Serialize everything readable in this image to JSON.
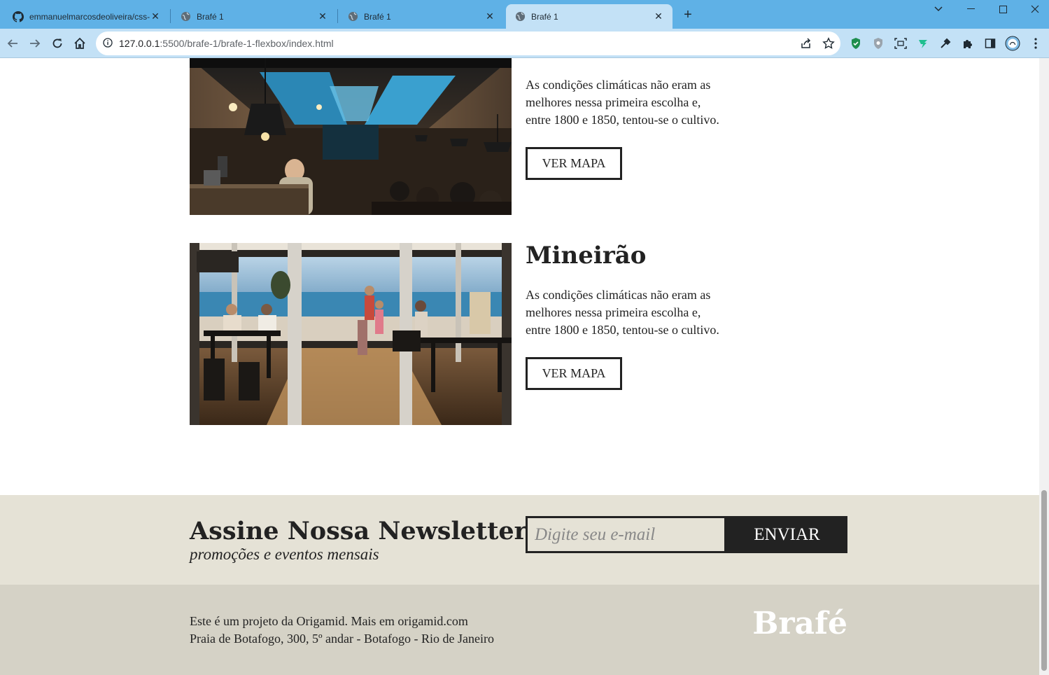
{
  "browser": {
    "tabs": [
      {
        "title": "emmanuelmarcosdeoliveira/css-a",
        "icon": "github-icon"
      },
      {
        "title": "Brafé 1",
        "icon": "globe-icon"
      },
      {
        "title": "Brafé 1",
        "icon": "globe-icon"
      },
      {
        "title": "Brafé 1",
        "icon": "globe-icon",
        "active": true
      }
    ],
    "url_host": "127.0.0.1",
    "url_rest": ":5500/brafe-1/brafe-1-flexbox/index.html"
  },
  "cards": [
    {
      "title": "",
      "body_lines": [
        "As condições climáticas não eram as",
        "melhores nessa primeira escolha e,",
        "entre 1800 e 1850, tentou-se o cultivo."
      ],
      "button": "VER MAPA"
    },
    {
      "title": "Mineirão",
      "body_lines": [
        "As condições climáticas não eram as",
        "melhores nessa primeira escolha e,",
        "entre 1800 e 1850, tentou-se o cultivo."
      ],
      "button": "VER MAPA"
    }
  ],
  "newsletter": {
    "title": "Assine Nossa Newsletter",
    "subtitle": "promoções e eventos mensais",
    "placeholder": "Digite seu e-mail",
    "button": "ENVIAR"
  },
  "footer": {
    "line1": "Este é um projeto da Origamid. Mais em origamid.com",
    "line2": "Praia de Botafogo, 300, 5º andar - Botafogo - Rio de Janeiro",
    "logo": "Brafé"
  },
  "colors": {
    "tabbar": "#5fb1e6",
    "toolbar": "#c3e1f6",
    "newsletter_bg": "#e5e2d6",
    "footer_bg": "#d5d2c6",
    "text": "#222222"
  }
}
